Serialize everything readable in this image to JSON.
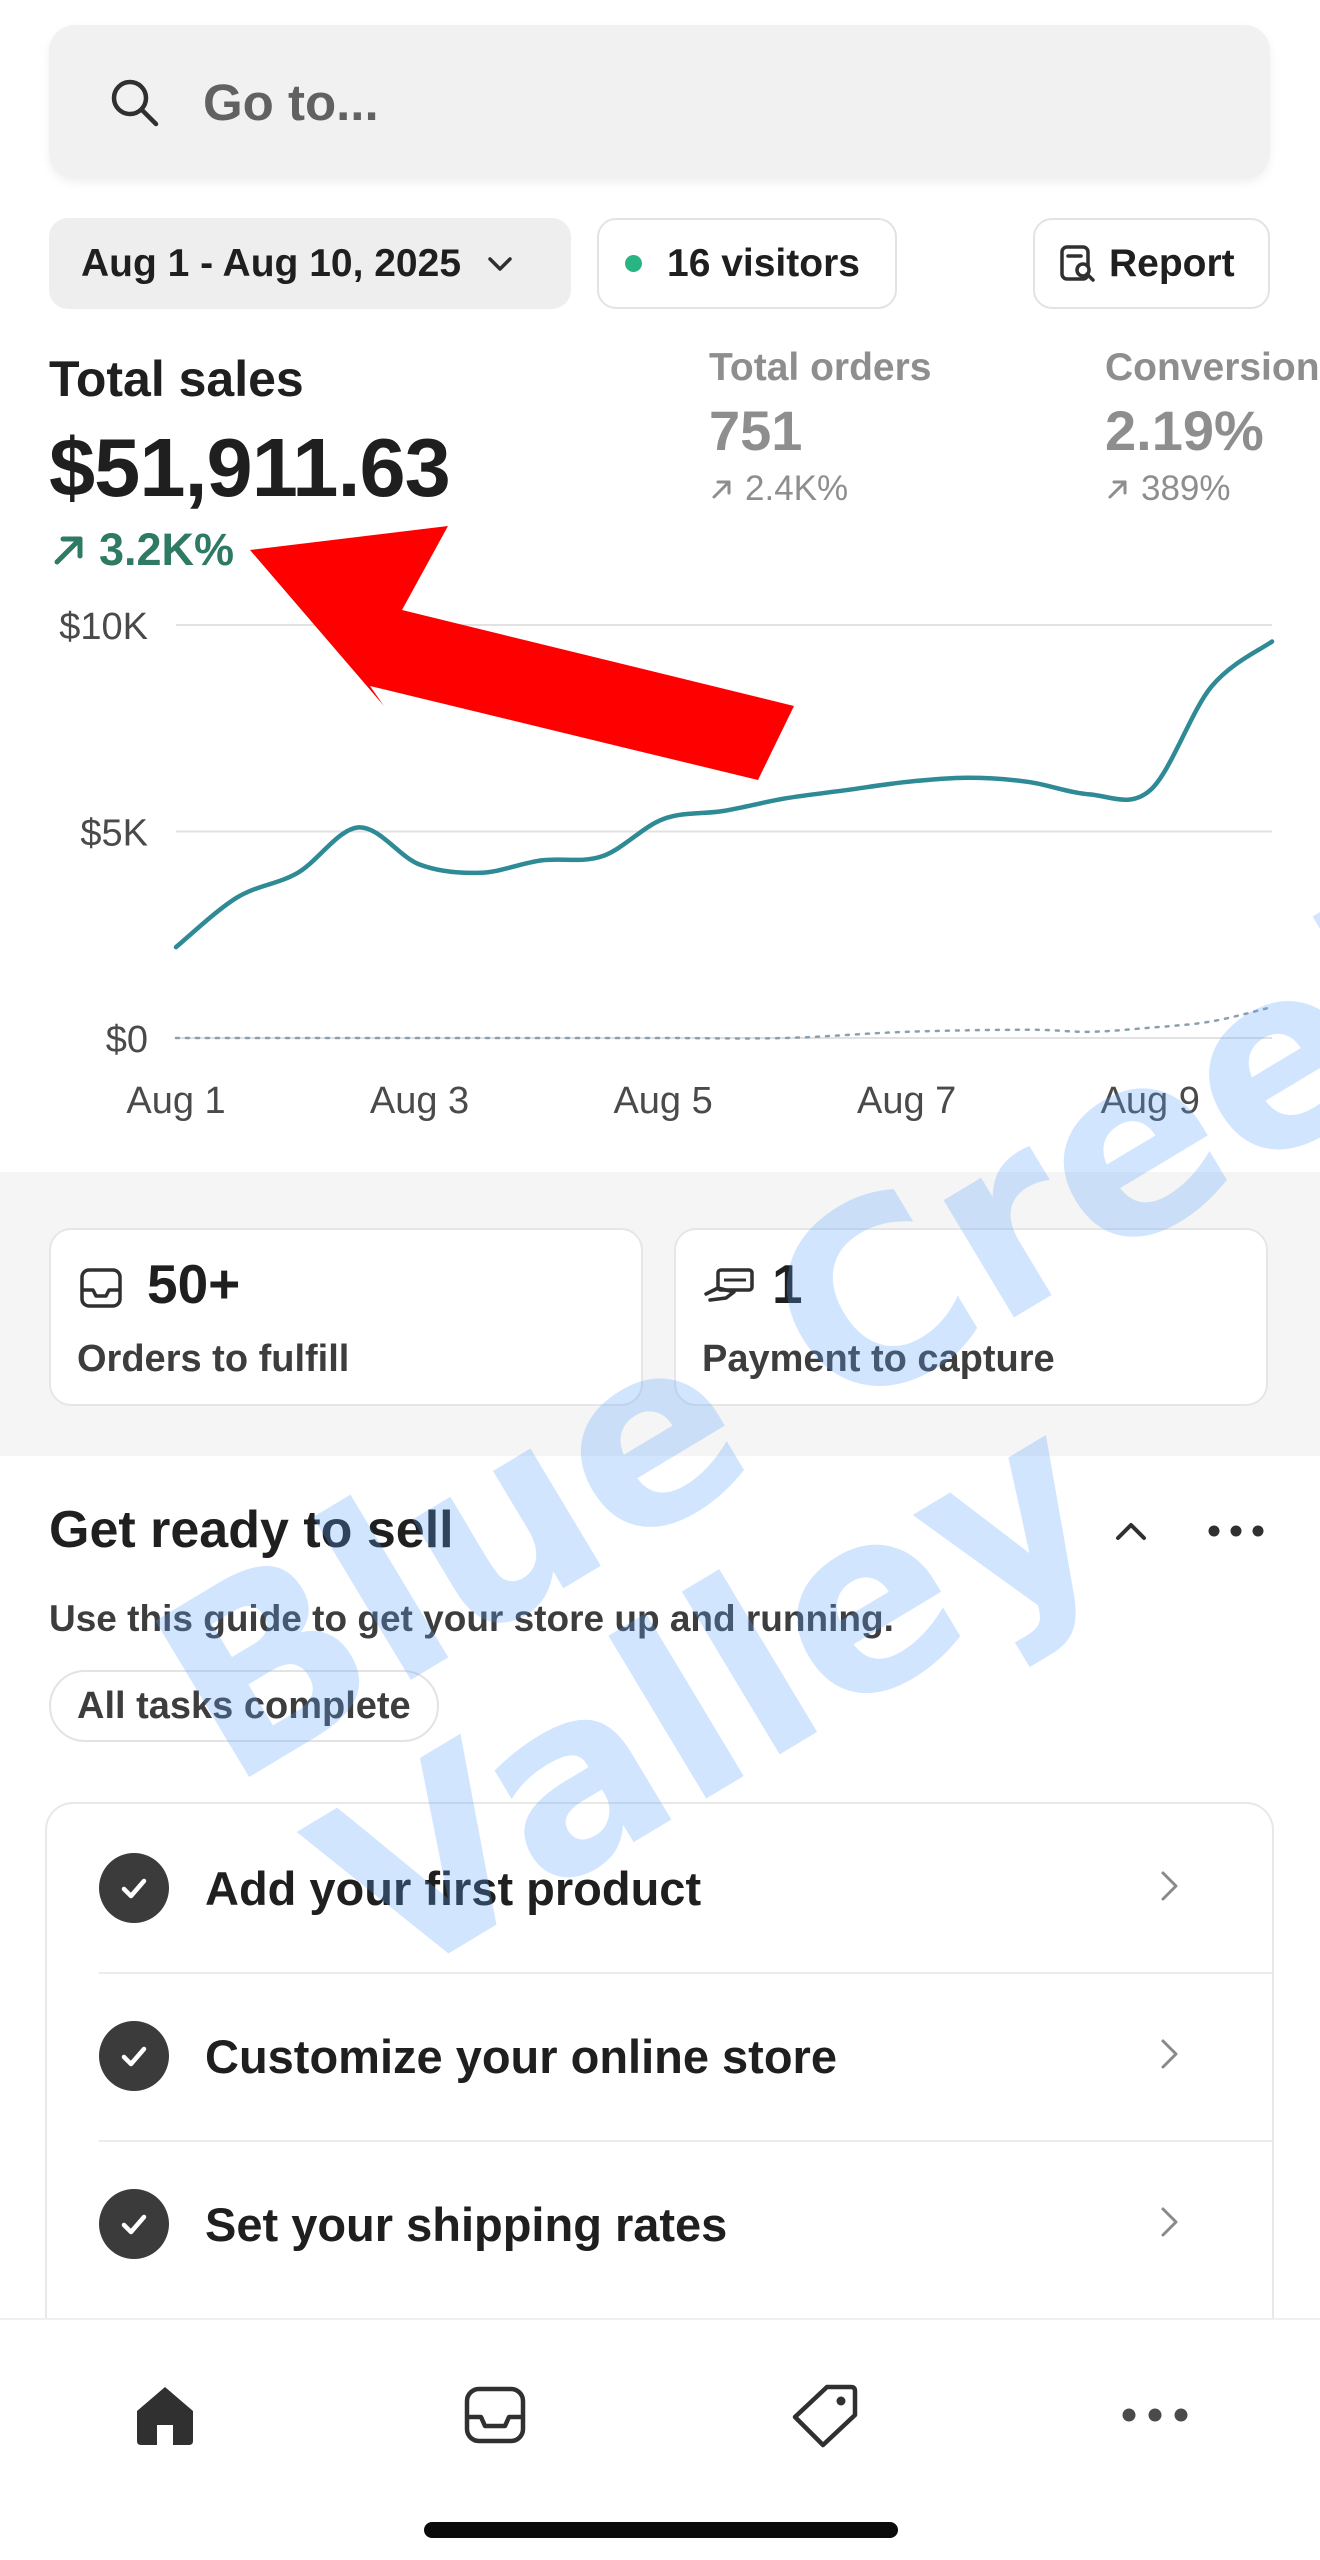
{
  "search": {
    "placeholder": "Go to..."
  },
  "filters": {
    "date_range": "Aug 1 - Aug 10, 2025",
    "visitors": "16 visitors",
    "report_label": "Report"
  },
  "metrics": {
    "total_sales": {
      "label": "Total sales",
      "value": "$51,911.63",
      "change": "3.2K%"
    },
    "total_orders": {
      "label": "Total orders",
      "value": "751",
      "change": "2.4K%"
    },
    "conversion": {
      "label": "Conversion",
      "value": "2.19%",
      "change": "389%"
    }
  },
  "chart_data": {
    "type": "line",
    "title": "",
    "xlabel": "",
    "ylabel": "",
    "y_ticks": [
      "$10K",
      "$5K",
      "$0"
    ],
    "ylim": [
      0,
      10000
    ],
    "x_ticks": [
      "Aug 1",
      "Aug 3",
      "Aug 5",
      "Aug 7",
      "Aug 9"
    ],
    "x_range": [
      1,
      10
    ],
    "grid": "horizontal",
    "series": [
      {
        "color": "#2e8a95",
        "style": "solid",
        "x": [
          1,
          1.5,
          2,
          2.5,
          3,
          3.5,
          4,
          4.5,
          5,
          5.5,
          6,
          6.5,
          7,
          7.5,
          8,
          8.5,
          9,
          9.5,
          10
        ],
        "values": [
          2200,
          3400,
          4000,
          5100,
          4200,
          4000,
          4300,
          4400,
          5300,
          5500,
          5800,
          6000,
          6200,
          6300,
          6200,
          5900,
          6000,
          8500,
          9600
        ]
      },
      {
        "color": "#8aa0b0",
        "style": "dotted",
        "x": [
          1,
          2,
          3,
          4,
          5,
          6,
          7,
          8,
          8.5,
          9,
          9.5,
          10
        ],
        "values": [
          0,
          0,
          0,
          0,
          0,
          0,
          150,
          200,
          150,
          250,
          400,
          750
        ]
      }
    ]
  },
  "cards": [
    {
      "icon": "inbox-icon",
      "value": "50+",
      "label": "Orders to fulfill"
    },
    {
      "icon": "hand-cash-icon",
      "value": "1",
      "label": "Payment to capture"
    }
  ],
  "guide": {
    "title": "Get ready to sell",
    "subtitle": "Use this guide to get your store up and running.",
    "badge": "All tasks complete",
    "tasks": [
      {
        "label": "Add your first product"
      },
      {
        "label": "Customize your online store"
      },
      {
        "label": "Set your shipping rates"
      }
    ]
  },
  "nav": [
    "home-icon",
    "orders-icon",
    "products-tag-icon",
    "more-icon"
  ],
  "watermark": {
    "line1": "Blue Creek",
    "line2": "Valley"
  },
  "colors": {
    "accent_green": "#2f7a64",
    "chart_line": "#2e8a95",
    "annotation_red": "#ff0000"
  }
}
